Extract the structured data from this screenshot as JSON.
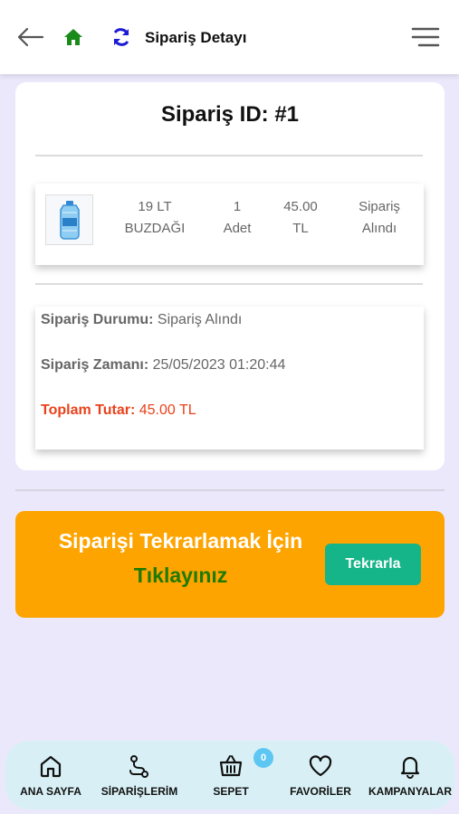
{
  "header": {
    "title": "Sipariş Detayı",
    "back_icon": "arrow-left-icon",
    "home_icon": "home-icon",
    "refresh_icon": "refresh-icon",
    "menu_icon": "hamburger-menu-icon",
    "colors": {
      "home": "#1a8a1a",
      "refresh": "#1b1bd6"
    }
  },
  "order": {
    "id_label": "Sipariş ID: #1",
    "item": {
      "image_icon": "water-bottle-icon",
      "name_line1": "19 LT",
      "name_line2": "BUZDAĞI",
      "qty_line1": "1",
      "qty_line2": "Adet",
      "price_line1": "45.00",
      "price_line2": "TL",
      "status_line1": "Sipariş",
      "status_line2": "Alındı"
    },
    "status_label": "Sipariş Durumu:",
    "status_value": "Sipariş Alındı",
    "time_label": "Sipariş Zamanı:",
    "time_value": "25/05/2023 01:20:44",
    "total_label": "Toplam Tutar:",
    "total_value": "45.00 TL",
    "total_color": "#e8421b"
  },
  "repeat": {
    "line1": "Siparişi Tekrarlamak İçin",
    "line2": "Tıklayınız",
    "button": "Tekrarla",
    "colors": {
      "background": "#fea400",
      "button": "#16b489",
      "highlight": "#1f7a00"
    }
  },
  "bottom_nav": {
    "items": [
      {
        "label": "ANA SAYFA",
        "icon": "home-outline-icon"
      },
      {
        "label": "SİPARİŞLERİM",
        "icon": "route-icon"
      },
      {
        "label": "SEPET",
        "icon": "basket-icon"
      },
      {
        "label": "FAVORİLER",
        "icon": "heart-icon"
      },
      {
        "label": "KAMPANYALAR",
        "icon": "bell-icon"
      }
    ],
    "cart_badge": "0"
  }
}
